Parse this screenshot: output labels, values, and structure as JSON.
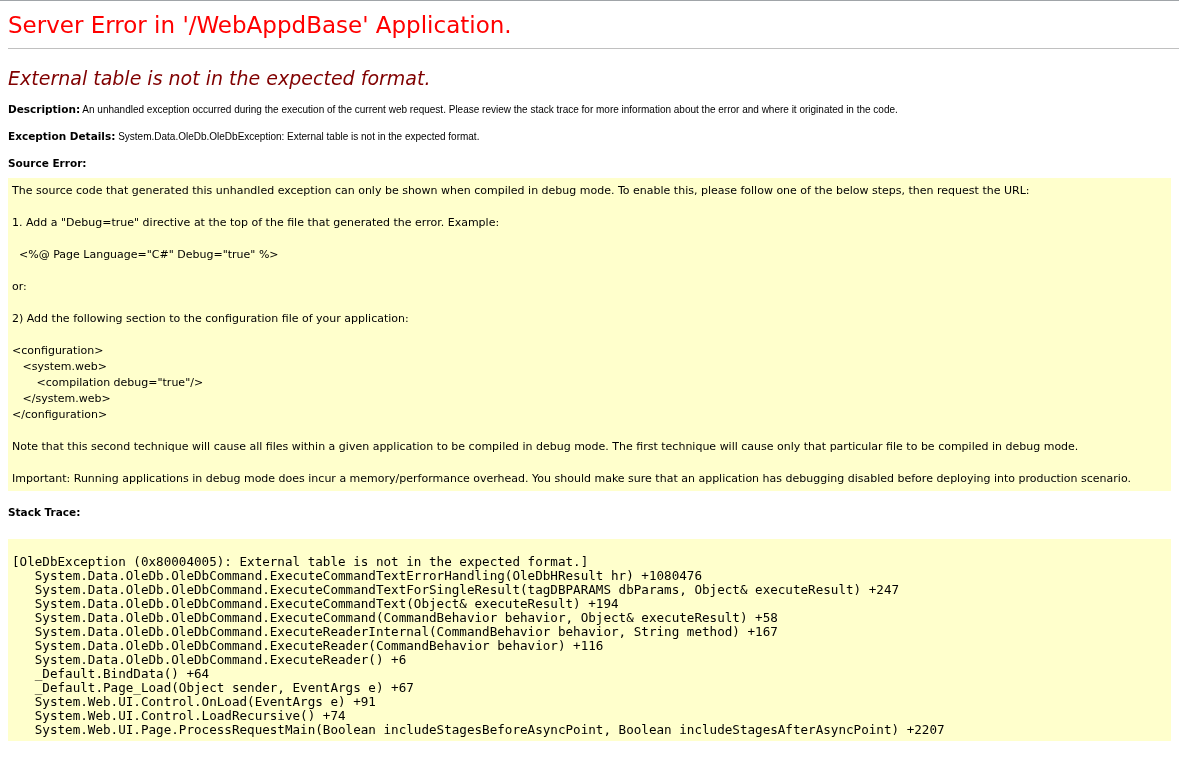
{
  "title": "Server Error in '/WebAppdBase' Application.",
  "error_message": "External table is not in the expected format.",
  "description": {
    "label": "Description:",
    "text": "An unhandled exception occurred during the execution of the current web request. Please review the stack trace for more information about the error and where it originated in the code."
  },
  "exception_details": {
    "label": "Exception Details:",
    "text": "System.Data.OleDb.OleDbException: External table is not in the expected format."
  },
  "source_error": {
    "heading": "Source Error:",
    "blocks": [
      {
        "kind": "text",
        "lines": [
          "The source code that generated this unhandled exception can only be shown when compiled in debug mode. To enable this, please follow one of the below steps, then request the URL:"
        ]
      },
      {
        "kind": "text",
        "lines": [
          "1. Add a \"Debug=true\" directive at the top of the file that generated the error. Example:"
        ]
      },
      {
        "kind": "text",
        "lines": [
          "  <%@ Page Language=\"C#\" Debug=\"true\" %>"
        ]
      },
      {
        "kind": "text",
        "lines": [
          "or:"
        ]
      },
      {
        "kind": "text",
        "lines": [
          "2) Add the following section to the configuration file of your application:"
        ]
      },
      {
        "kind": "text",
        "lines": [
          "<configuration>",
          "   <system.web>",
          "       <compilation debug=\"true\"/>",
          "   </system.web>",
          "</configuration>"
        ]
      },
      {
        "kind": "text",
        "lines": [
          "Note that this second technique will cause all files within a given application to be compiled in debug mode. The first technique will cause only that particular file to be compiled in debug mode."
        ]
      },
      {
        "kind": "text",
        "lines": [
          "Important: Running applications in debug mode does incur a memory/performance overhead. You should make sure that an application has debugging disabled before deploying into production scenario."
        ]
      }
    ]
  },
  "stack_trace": {
    "heading": "Stack Trace:",
    "lines": [
      "[OleDbException (0x80004005): External table is not in the expected format.]",
      "   System.Data.OleDb.OleDbCommand.ExecuteCommandTextErrorHandling(OleDbHResult hr) +1080476",
      "   System.Data.OleDb.OleDbCommand.ExecuteCommandTextForSingleResult(tagDBPARAMS dbParams, Object& executeResult) +247",
      "   System.Data.OleDb.OleDbCommand.ExecuteCommandText(Object& executeResult) +194",
      "   System.Data.OleDb.OleDbCommand.ExecuteCommand(CommandBehavior behavior, Object& executeResult) +58",
      "   System.Data.OleDb.OleDbCommand.ExecuteReaderInternal(CommandBehavior behavior, String method) +167",
      "   System.Data.OleDb.OleDbCommand.ExecuteReader(CommandBehavior behavior) +116",
      "   System.Data.OleDb.OleDbCommand.ExecuteReader() +6",
      "   _Default.BindData() +64",
      "   _Default.Page_Load(Object sender, EventArgs e) +67",
      "   System.Web.UI.Control.OnLoad(EventArgs e) +91",
      "   System.Web.UI.Control.LoadRecursive() +74",
      "   System.Web.UI.Page.ProcessRequestMain(Boolean includeStagesBeforeAsyncPoint, Boolean includeStagesAfterAsyncPoint) +2207"
    ]
  }
}
